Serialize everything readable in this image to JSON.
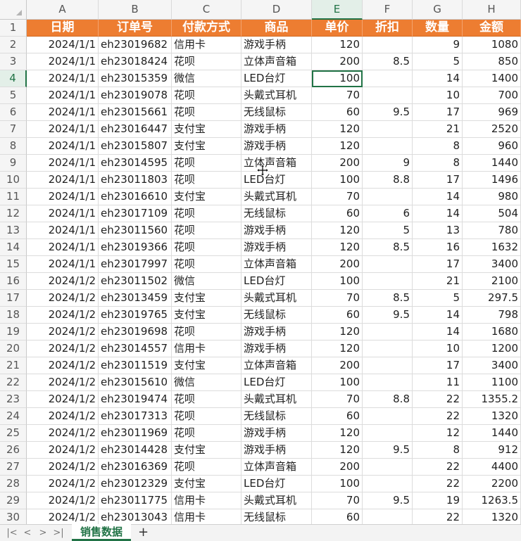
{
  "sheet": {
    "active_cell": "E4",
    "column_letters": [
      "A",
      "B",
      "C",
      "D",
      "E",
      "F",
      "G",
      "H"
    ],
    "headers": [
      "日期",
      "订单号",
      "付款方式",
      "商品",
      "单价",
      "折扣",
      "数量",
      "金额"
    ],
    "rows": [
      [
        "2024/1/1",
        "eh23019682",
        "信用卡",
        "游戏手柄",
        "120",
        "",
        "9",
        "1080"
      ],
      [
        "2024/1/1",
        "eh23018424",
        "花呗",
        "立体声音箱",
        "200",
        "8.5",
        "5",
        "850"
      ],
      [
        "2024/1/1",
        "eh23015359",
        "微信",
        "LED台灯",
        "100",
        "",
        "14",
        "1400"
      ],
      [
        "2024/1/1",
        "eh23019078",
        "花呗",
        "头戴式耳机",
        "70",
        "",
        "10",
        "700"
      ],
      [
        "2024/1/1",
        "eh23015661",
        "花呗",
        "无线鼠标",
        "60",
        "9.5",
        "17",
        "969"
      ],
      [
        "2024/1/1",
        "eh23016447",
        "支付宝",
        "游戏手柄",
        "120",
        "",
        "21",
        "2520"
      ],
      [
        "2024/1/1",
        "eh23015807",
        "支付宝",
        "游戏手柄",
        "120",
        "",
        "8",
        "960"
      ],
      [
        "2024/1/1",
        "eh23014595",
        "花呗",
        "立体声音箱",
        "200",
        "9",
        "8",
        "1440"
      ],
      [
        "2024/1/1",
        "eh23011803",
        "花呗",
        "LED台灯",
        "100",
        "8.8",
        "17",
        "1496"
      ],
      [
        "2024/1/1",
        "eh23016610",
        "支付宝",
        "头戴式耳机",
        "70",
        "",
        "14",
        "980"
      ],
      [
        "2024/1/1",
        "eh23017109",
        "花呗",
        "无线鼠标",
        "60",
        "6",
        "14",
        "504"
      ],
      [
        "2024/1/1",
        "eh23011560",
        "花呗",
        "游戏手柄",
        "120",
        "5",
        "13",
        "780"
      ],
      [
        "2024/1/1",
        "eh23019366",
        "花呗",
        "游戏手柄",
        "120",
        "8.5",
        "16",
        "1632"
      ],
      [
        "2024/1/1",
        "eh23017997",
        "花呗",
        "立体声音箱",
        "200",
        "",
        "17",
        "3400"
      ],
      [
        "2024/1/2",
        "eh23011502",
        "微信",
        "LED台灯",
        "100",
        "",
        "21",
        "2100"
      ],
      [
        "2024/1/2",
        "eh23013459",
        "支付宝",
        "头戴式耳机",
        "70",
        "8.5",
        "5",
        "297.5"
      ],
      [
        "2024/1/2",
        "eh23019765",
        "支付宝",
        "无线鼠标",
        "60",
        "9.5",
        "14",
        "798"
      ],
      [
        "2024/1/2",
        "eh23019698",
        "花呗",
        "游戏手柄",
        "120",
        "",
        "14",
        "1680"
      ],
      [
        "2024/1/2",
        "eh23014557",
        "信用卡",
        "游戏手柄",
        "120",
        "",
        "10",
        "1200"
      ],
      [
        "2024/1/2",
        "eh23011519",
        "支付宝",
        "立体声音箱",
        "200",
        "",
        "17",
        "3400"
      ],
      [
        "2024/1/2",
        "eh23015610",
        "微信",
        "LED台灯",
        "100",
        "",
        "11",
        "1100"
      ],
      [
        "2024/1/2",
        "eh23019474",
        "花呗",
        "头戴式耳机",
        "70",
        "8.8",
        "22",
        "1355.2"
      ],
      [
        "2024/1/2",
        "eh23017313",
        "花呗",
        "无线鼠标",
        "60",
        "",
        "22",
        "1320"
      ],
      [
        "2024/1/2",
        "eh23011969",
        "花呗",
        "游戏手柄",
        "120",
        "",
        "12",
        "1440"
      ],
      [
        "2024/1/2",
        "eh23014428",
        "支付宝",
        "游戏手柄",
        "120",
        "9.5",
        "8",
        "912"
      ],
      [
        "2024/1/2",
        "eh23016369",
        "花呗",
        "立体声音箱",
        "200",
        "",
        "22",
        "4400"
      ],
      [
        "2024/1/2",
        "eh23012329",
        "支付宝",
        "LED台灯",
        "100",
        "",
        "22",
        "2200"
      ],
      [
        "2024/1/2",
        "eh23011775",
        "信用卡",
        "头戴式耳机",
        "70",
        "9.5",
        "19",
        "1263.5"
      ],
      [
        "2024/1/2",
        "eh23013043",
        "信用卡",
        "无线鼠标",
        "60",
        "",
        "22",
        "1320"
      ]
    ]
  },
  "tabs": {
    "active_sheet": "销售数据",
    "add_label": "+",
    "nav_first": "|<",
    "nav_prev": "<",
    "nav_next": ">",
    "nav_last": ">|"
  },
  "colors": {
    "header_fill": "#ED7D31",
    "accent": "#217346"
  }
}
